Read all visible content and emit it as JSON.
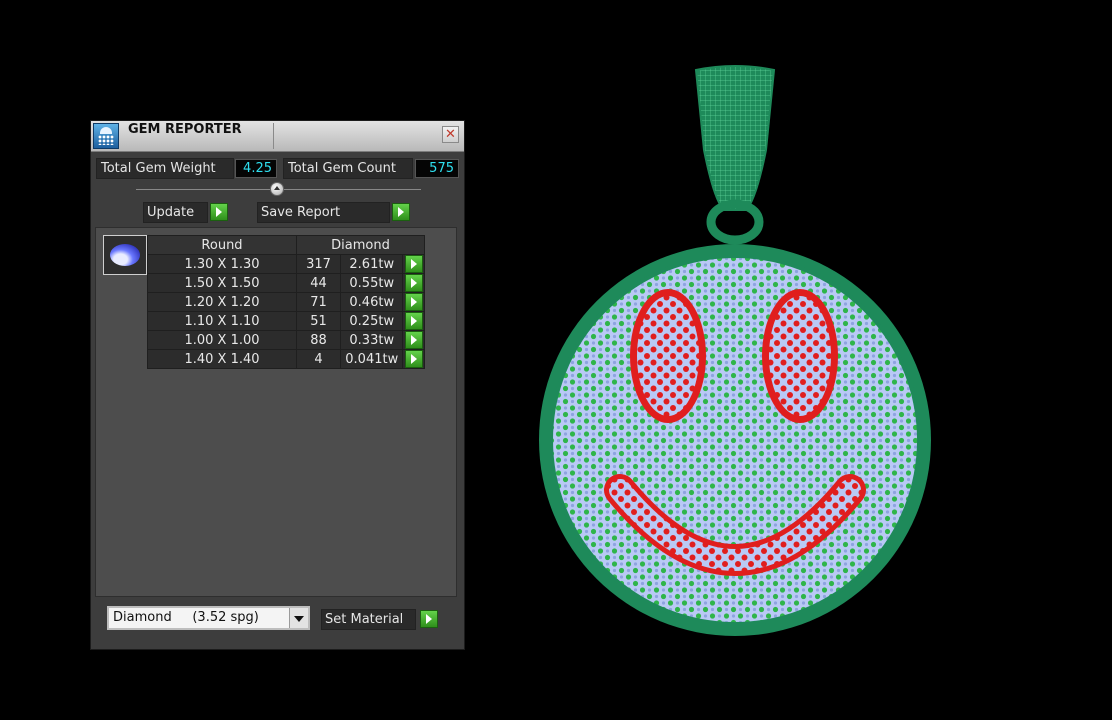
{
  "window": {
    "title": "GEM REPORTER",
    "close_symbol": "✕"
  },
  "summary": {
    "total_weight_label": "Total Gem Weight",
    "total_weight_value": "4.25",
    "total_count_label": "Total Gem Count",
    "total_count_value": "575"
  },
  "actions": {
    "update_label": "Update",
    "save_label": "Save Report"
  },
  "table": {
    "shape_header": "Round",
    "material_header": "Diamond",
    "rows": [
      {
        "size": "1.30 X 1.30",
        "count": "317",
        "weight": "2.61tw"
      },
      {
        "size": "1.50 X 1.50",
        "count": "44",
        "weight": "0.55tw"
      },
      {
        "size": "1.20 X 1.20",
        "count": "71",
        "weight": "0.46tw"
      },
      {
        "size": "1.10 X 1.10",
        "count": "51",
        "weight": "0.25tw"
      },
      {
        "size": "1.00 X 1.00",
        "count": "88",
        "weight": "0.33tw"
      },
      {
        "size": "1.40 X 1.40",
        "count": "4",
        "weight": "0.041tw"
      }
    ]
  },
  "material": {
    "selected": "Diamond     (3.52 spg)",
    "set_label": "Set Material"
  },
  "colors": {
    "metal": "#1e8a5a",
    "stone_face": "#b9c9f5",
    "accent_green": "#2fb54a",
    "accent_red": "#e01e1e",
    "value_cyan": "#2fe0f0"
  },
  "icons": {
    "logo": "gem-reporter-logo-icon",
    "gem": "round-gem-icon",
    "go": "green-play-arrow-icon",
    "close": "close-icon",
    "dropdown": "chevron-down-icon"
  }
}
